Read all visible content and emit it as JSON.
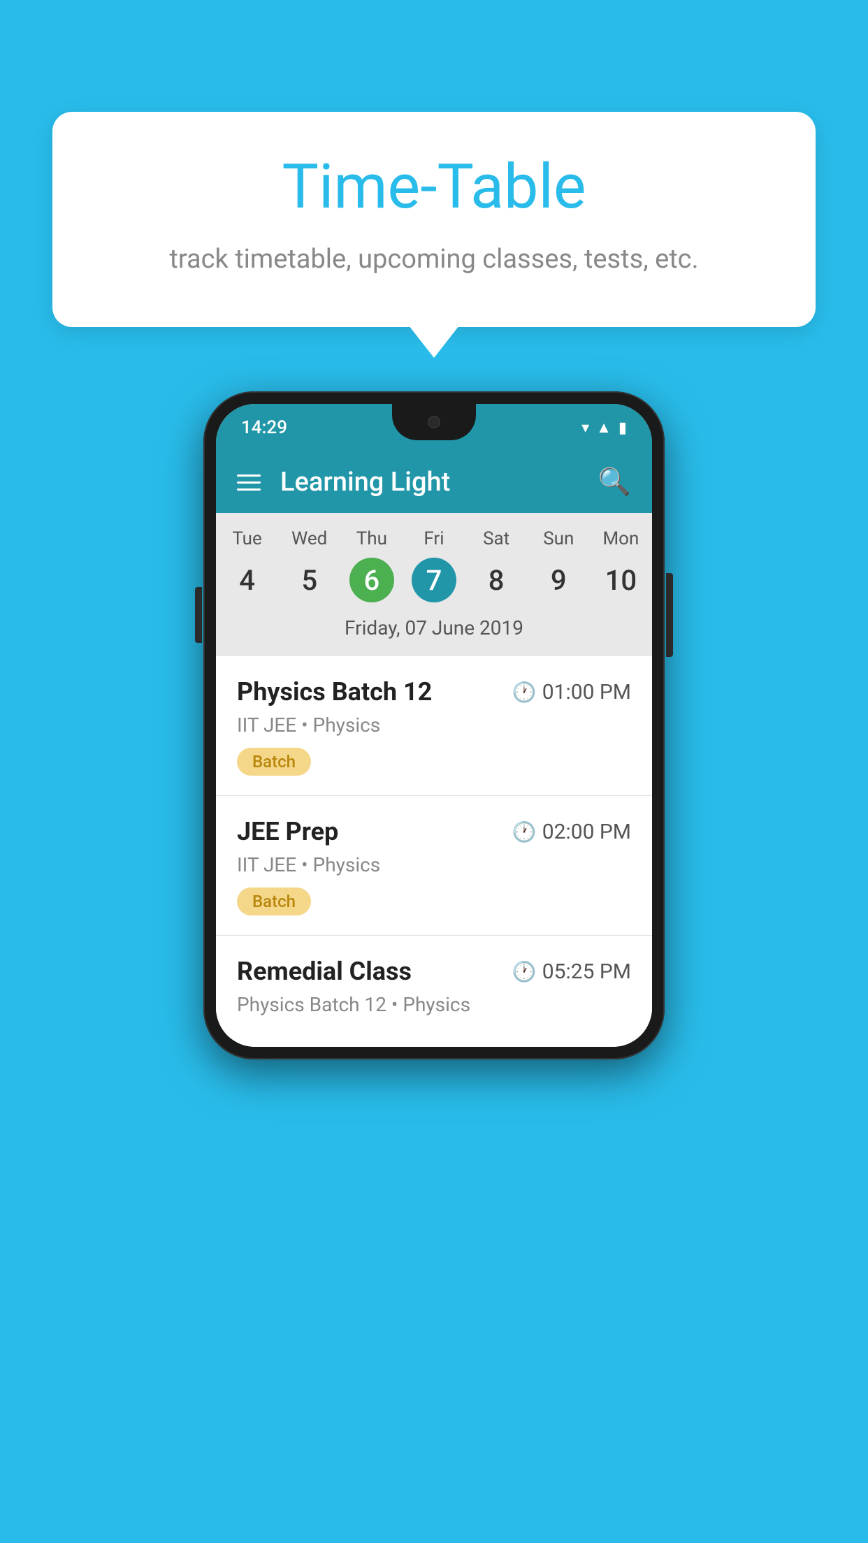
{
  "page": {
    "background_color": "#29BCEA"
  },
  "speech_bubble": {
    "title": "Time-Table",
    "subtitle": "track timetable, upcoming classes, tests, etc."
  },
  "phone": {
    "status_bar": {
      "time": "14:29"
    },
    "app_bar": {
      "title": "Learning Light"
    },
    "calendar": {
      "day_headers": [
        "Tue",
        "Wed",
        "Thu",
        "Fri",
        "Sat",
        "Sun",
        "Mon"
      ],
      "day_numbers": [
        "4",
        "5",
        "6",
        "7",
        "8",
        "9",
        "10"
      ],
      "today_index": 2,
      "selected_index": 3,
      "date_label": "Friday, 07 June 2019"
    },
    "schedule_items": [
      {
        "title": "Physics Batch 12",
        "time": "01:00 PM",
        "subtitle": "IIT JEE • Physics",
        "tag": "Batch"
      },
      {
        "title": "JEE Prep",
        "time": "02:00 PM",
        "subtitle": "IIT JEE • Physics",
        "tag": "Batch"
      },
      {
        "title": "Remedial Class",
        "time": "05:25 PM",
        "subtitle": "Physics Batch 12 • Physics",
        "tag": ""
      }
    ]
  }
}
